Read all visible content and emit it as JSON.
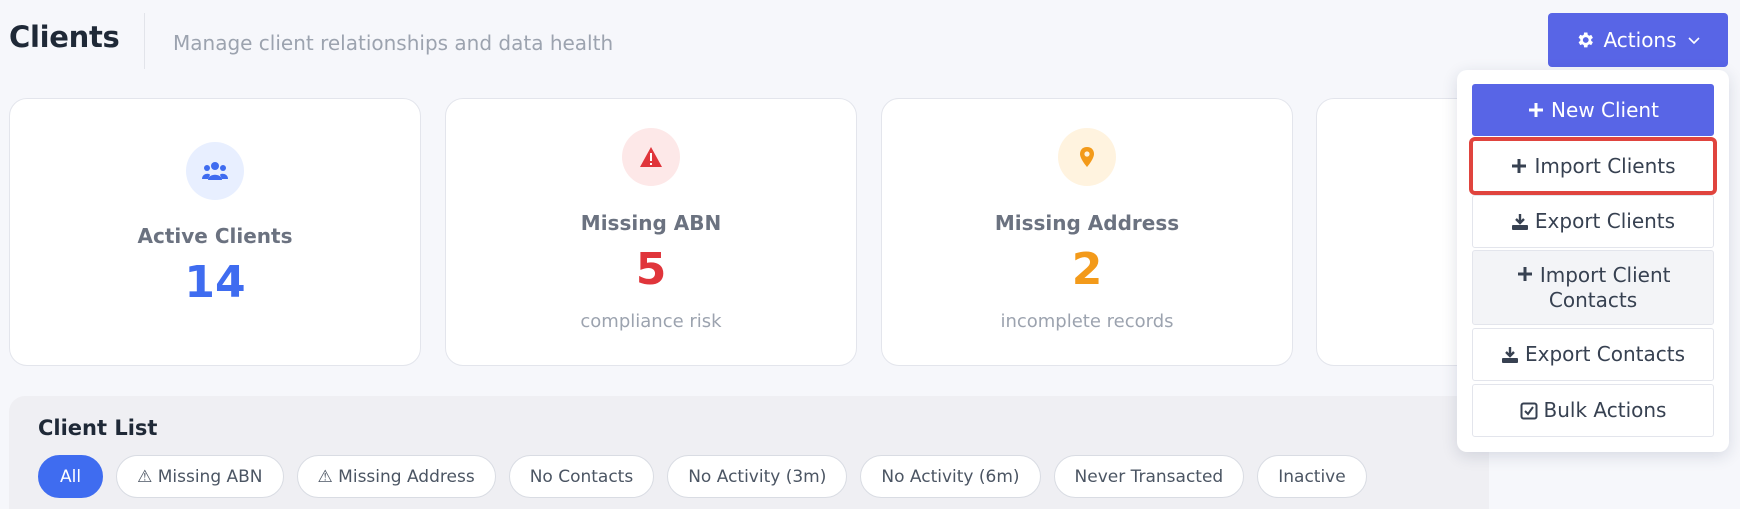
{
  "header": {
    "title": "Clients",
    "subtitle": "Manage client relationships and data health",
    "actions_label": "Actions"
  },
  "stats": [
    {
      "label": "Active Clients",
      "value": "14",
      "sub": "",
      "icon": "users-icon",
      "color": "#3f6cf0",
      "bg": "#e8efff"
    },
    {
      "label": "Missing ABN",
      "value": "5",
      "sub": "compliance risk",
      "icon": "warning-icon",
      "color": "#e0353b",
      "bg": "#fde8e8"
    },
    {
      "label": "Missing Address",
      "value": "2",
      "sub": "incomplete records",
      "icon": "map-pin-icon",
      "color": "#f39a1a",
      "bg": "#fff3df"
    }
  ],
  "client_list": {
    "title": "Client List",
    "filters": [
      "All",
      "⚠ Missing ABN",
      "⚠ Missing Address",
      "No Contacts",
      "No Activity (3m)",
      "No Activity (6m)",
      "Never Transacted",
      "Inactive"
    ]
  },
  "actions_menu": {
    "items": [
      {
        "label": "New Client",
        "icon": "plus-icon"
      },
      {
        "label": "Import Clients",
        "icon": "plus-icon"
      },
      {
        "label": "Export Clients",
        "icon": "download-icon"
      },
      {
        "label": "Import Client Contacts",
        "icon": "plus-icon"
      },
      {
        "label": "Export Contacts",
        "icon": "download-icon"
      },
      {
        "label": "Bulk Actions",
        "icon": "checkbox-icon"
      }
    ]
  },
  "colors": {
    "accent": "#5865e6",
    "filter_active": "#3f6cf0",
    "highlight_outline": "#e0443e"
  }
}
